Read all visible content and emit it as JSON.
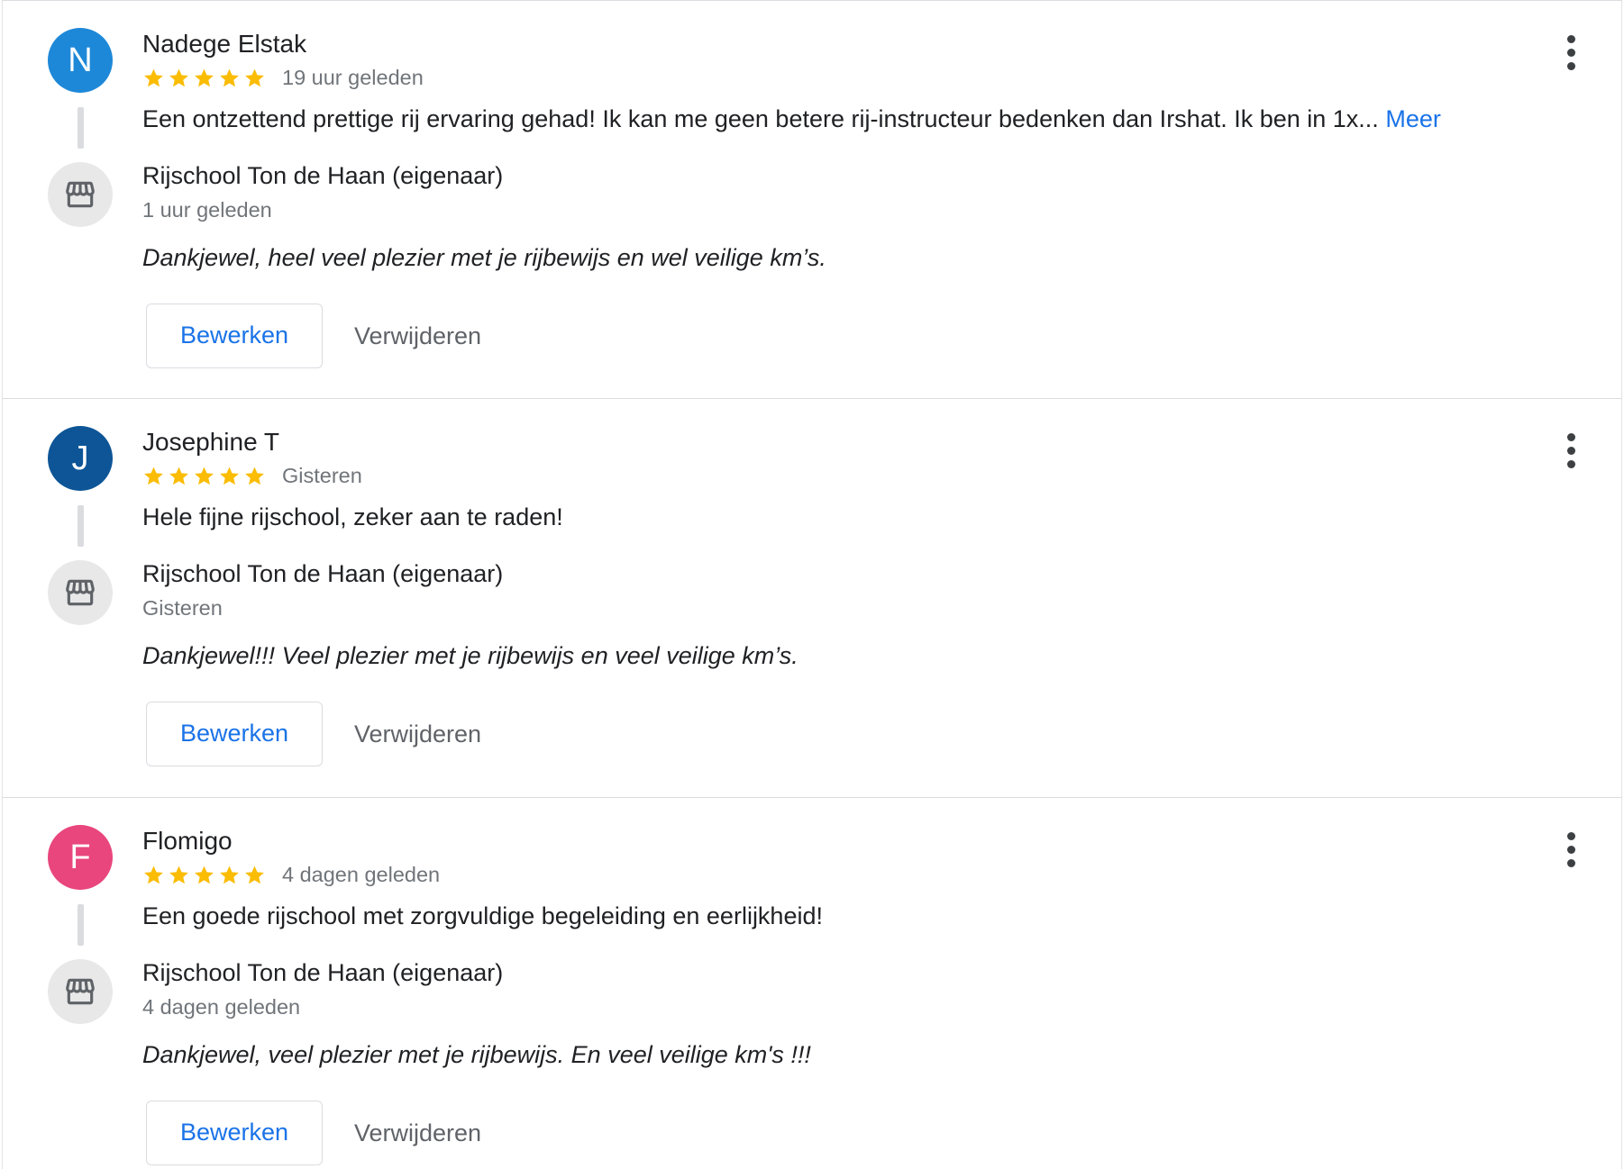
{
  "reviews": [
    {
      "initial": "N",
      "avatar_color": "#1e88d8",
      "name": "Nadege Elstak",
      "stars": 5,
      "date": "19 uur geleden",
      "text": "Een ontzettend prettige rij ervaring gehad! Ik kan me geen betere rij-instructeur bedenken dan Irshat. Ik ben in 1x...",
      "more_label": "Meer",
      "owner_name": "Rijschool Ton de Haan (eigenaar)",
      "owner_date": "1 uur geleden",
      "owner_reply": "Dankjewel, heel veel plezier met je rijbewijs en wel veilige km’s.",
      "edit_label": "Bewerken",
      "delete_label": "Verwijderen"
    },
    {
      "initial": "J",
      "avatar_color": "#0d5596",
      "name": "Josephine T",
      "stars": 5,
      "date": "Gisteren",
      "text": "Hele fijne rijschool, zeker aan te raden!",
      "more_label": "",
      "owner_name": "Rijschool Ton de Haan (eigenaar)",
      "owner_date": "Gisteren",
      "owner_reply": "Dankjewel!!! Veel plezier met je rijbewijs en veel veilige km’s.",
      "edit_label": "Bewerken",
      "delete_label": "Verwijderen"
    },
    {
      "initial": "F",
      "avatar_color": "#e8467c",
      "name": "Flomigo",
      "stars": 5,
      "date": "4 dagen geleden",
      "text": "Een goede rijschool met zorgvuldige begeleiding en eerlijkheid!",
      "more_label": "",
      "owner_name": "Rijschool Ton de Haan (eigenaar)",
      "owner_date": "4 dagen geleden",
      "owner_reply": "Dankjewel, veel plezier met je rijbewijs. En veel veilige km's !!!",
      "edit_label": "Bewerken",
      "delete_label": "Verwijderen"
    }
  ],
  "icons": {
    "star": "star-icon",
    "owner": "storefront-icon",
    "menu": "more-vert-icon"
  },
  "colors": {
    "star": "#fbbc04",
    "link": "#1a73e8",
    "muted": "#70757a"
  }
}
